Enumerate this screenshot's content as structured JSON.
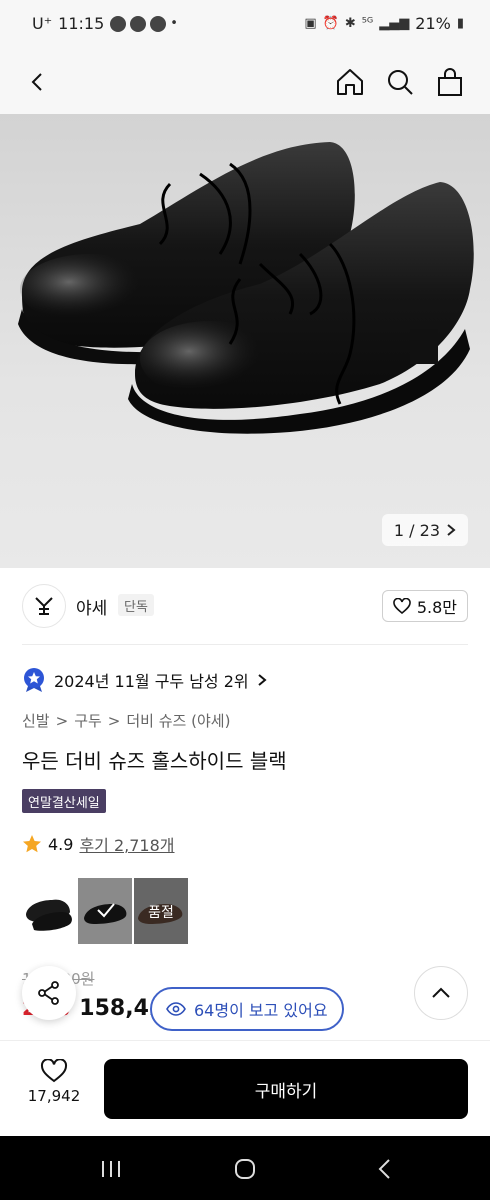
{
  "status_bar": {
    "carrier": "U⁺",
    "time": "11:15",
    "battery": "21%"
  },
  "nav": {
    "icons": [
      "back-arrow-icon",
      "home-icon",
      "search-icon",
      "shopping-bag-icon"
    ]
  },
  "hero": {
    "image_description_icon": "shoe-photo",
    "counter": "1 / 23"
  },
  "brand": {
    "logo_text": "𝔜",
    "name": "야세",
    "badge": "단독",
    "likes": "5.8만"
  },
  "ranking": {
    "text": "2024년 11월 구두 남성 2위"
  },
  "breadcrumb": {
    "items": [
      "신발",
      "구두",
      "더비 슈즈 (야세)"
    ],
    "sep": ">"
  },
  "product": {
    "title": "우든 더비 슈즈 홀스하이드 블랙",
    "sale_badge": "연말결산세일",
    "rating": "4.9",
    "review": "후기 2,718개",
    "original_price": "1‥‥‥00원",
    "discount": "2‥%",
    "price": "158,4‥",
    "soldout_label": "품절"
  },
  "viewers": {
    "text": "64명이 보고 있어요"
  },
  "bottom_bar": {
    "wish_count": "17,942",
    "buy_label": "구매하기"
  },
  "colors": {
    "accent_blue": "#3f61c8",
    "discount_red": "#e0242e",
    "sale_badge_bg": "#4a3e63",
    "star": "#f5a623"
  }
}
